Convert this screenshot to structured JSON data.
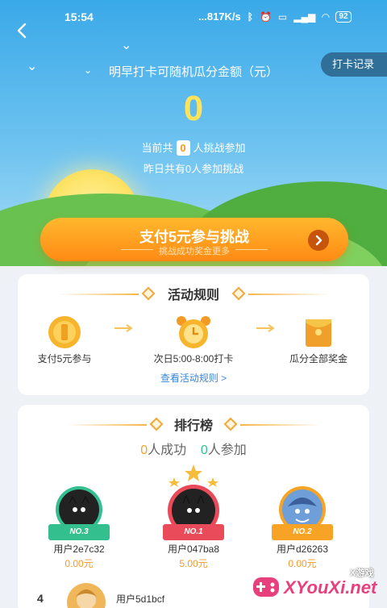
{
  "status_bar": {
    "time": "15:54",
    "network": "...817K/s",
    "battery": "92"
  },
  "header": {
    "back_icon": "chevron-left-icon",
    "record_label": "打卡记录",
    "title": "明早打卡可随机瓜分金额（元）",
    "amount": "0",
    "current_prefix": "当前共",
    "current_count": "0",
    "current_suffix": "人挑战参加",
    "yesterday": "昨日共有0人参加挑战"
  },
  "pay_button": {
    "label": "支付5元参与挑战",
    "sub": "挑战成功奖金更多",
    "icon": "chevron-right-icon"
  },
  "rules": {
    "title": "活动规则",
    "steps": [
      {
        "icon": "coin-icon",
        "label": "支付5元参与"
      },
      {
        "icon": "alarm-clock-icon",
        "label": "次日5:00-8:00打卡"
      },
      {
        "icon": "red-envelope-icon",
        "label": "瓜分全部奖金"
      }
    ],
    "link": "查看活动规则 >"
  },
  "leaderboard": {
    "title": "排行榜",
    "success_count": "0",
    "success_label": "人成功",
    "join_count": "0",
    "join_label": "人参加",
    "top3": [
      {
        "rank": "NO.3",
        "name": "用户2e7c32",
        "amount": "0.00元",
        "ribbon_color": "#33bf8e"
      },
      {
        "rank": "NO.1",
        "name": "用户047ba8",
        "amount": "5.00元",
        "ribbon_color": "#e94b5a"
      },
      {
        "rank": "NO.2",
        "name": "用户d26263",
        "amount": "0.00元",
        "ribbon_color": "#f6a326"
      }
    ],
    "rows": [
      {
        "rank": "4",
        "name": "用户5d1bcf"
      }
    ]
  },
  "watermark": {
    "line1": "X游戏",
    "line2": "XYouXi.net"
  },
  "colors": {
    "accent_orange": "#ff8a14",
    "link_blue": "#3a86d6",
    "amount_yellow": "#fde35c"
  }
}
